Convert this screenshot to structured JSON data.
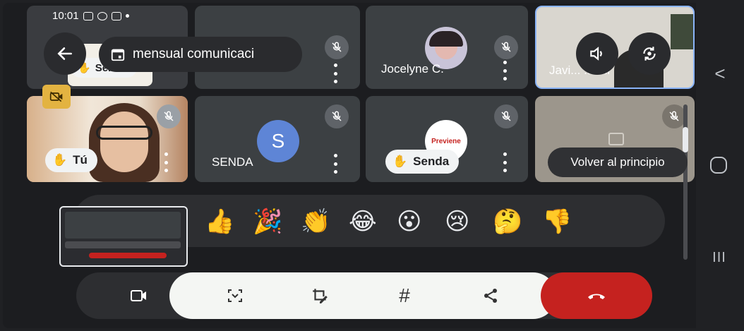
{
  "status_bar": {
    "time": "10:01"
  },
  "header": {
    "title": "mensual comunicaci",
    "back_icon": "arrow-left-icon",
    "calendar_icon": "calendar-icon"
  },
  "tiles": [
    {
      "name": "Senda",
      "has_raise_hand": true
    },
    {
      "name": "",
      "muted": true
    },
    {
      "name": "Jocelyne C.",
      "muted": true
    },
    {
      "name": "Javi... ...ani",
      "muted": false
    },
    {
      "name": "Tú",
      "has_raise_hand": true,
      "muted": true
    },
    {
      "name": "SENDA",
      "avatar_letter": "S",
      "muted": true
    },
    {
      "name": "Senda",
      "has_raise_hand": true,
      "muted": true,
      "logo_text": "Previene"
    },
    {
      "name": "",
      "muted": true
    }
  ],
  "tooltip": "Volver al principio",
  "reactions": [
    "👍",
    "🎉",
    "👏",
    "😂",
    "😮",
    "😢",
    "🤔",
    "👎"
  ],
  "toolbar": {
    "camera_icon": "video-camera-icon",
    "capture_icon": "screen-capture-icon",
    "edit_icon": "edit-screenshot-icon",
    "hashtag_icon": "hashtag-icon",
    "hashtag_label": "#",
    "share_icon": "share-icon",
    "end_call_icon": "end-call-icon"
  },
  "nav": {
    "back_icon": "nav-back-icon",
    "home_icon": "nav-home-icon",
    "recents_icon": "nav-recents-icon",
    "back_label": "<",
    "recents_label": "III"
  },
  "colors": {
    "background": "#202124",
    "tile": "#3c4043",
    "end_call": "#c5221f",
    "avatar_blue": "#5e85d6",
    "hand_yellow": "#e3b341"
  }
}
